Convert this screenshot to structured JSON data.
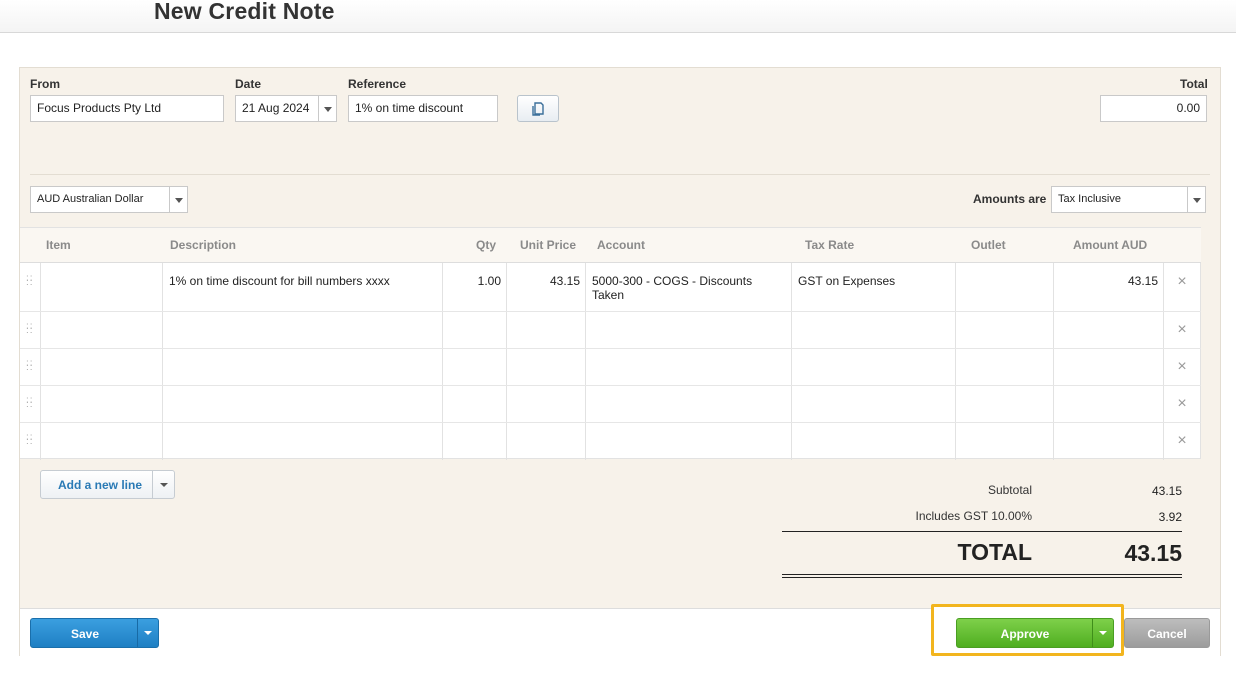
{
  "page": {
    "title": "New Credit Note"
  },
  "form": {
    "from_label": "From",
    "from_value": "Focus Products Pty Ltd",
    "date_label": "Date",
    "date_value": "21 Aug 2024",
    "reference_label": "Reference",
    "reference_value": "1% on time discount",
    "total_label": "Total",
    "total_value": "0.00",
    "currency_value": "AUD Australian Dollar",
    "amounts_are_label": "Amounts are",
    "amounts_are_value": "Tax Inclusive"
  },
  "table": {
    "headers": [
      "Item",
      "Description",
      "Qty",
      "Unit Price",
      "Account",
      "Tax Rate",
      "Outlet",
      "Amount AUD"
    ],
    "rows": [
      {
        "item": "",
        "description": "1% on time discount for bill numbers xxxx",
        "qty": "1.00",
        "unit_price": "43.15",
        "account": "5000-300 - COGS - Discounts Taken",
        "tax_rate": "GST on Expenses",
        "outlet": "",
        "amount": "43.15"
      }
    ],
    "empty_row_count": 4
  },
  "actions": {
    "add_line_label": "Add a new line",
    "save_label": "Save",
    "approve_label": "Approve",
    "cancel_label": "Cancel"
  },
  "summary": {
    "subtotal_label": "Subtotal",
    "subtotal_value": "43.15",
    "gst_label": "Includes GST 10.00%",
    "gst_value": "3.92",
    "total_label": "TOTAL",
    "total_value": "43.15"
  },
  "colors": {
    "panel_bg": "#f7f2ea",
    "save_blue": "#1f7fc3",
    "approve_green": "#4fae20",
    "highlight_yellow": "#f2b51e",
    "link_blue": "#2a7ab5"
  },
  "icons": [
    "copy-icon",
    "chevron-down-icon",
    "drag-handle-icon",
    "close-icon"
  ]
}
